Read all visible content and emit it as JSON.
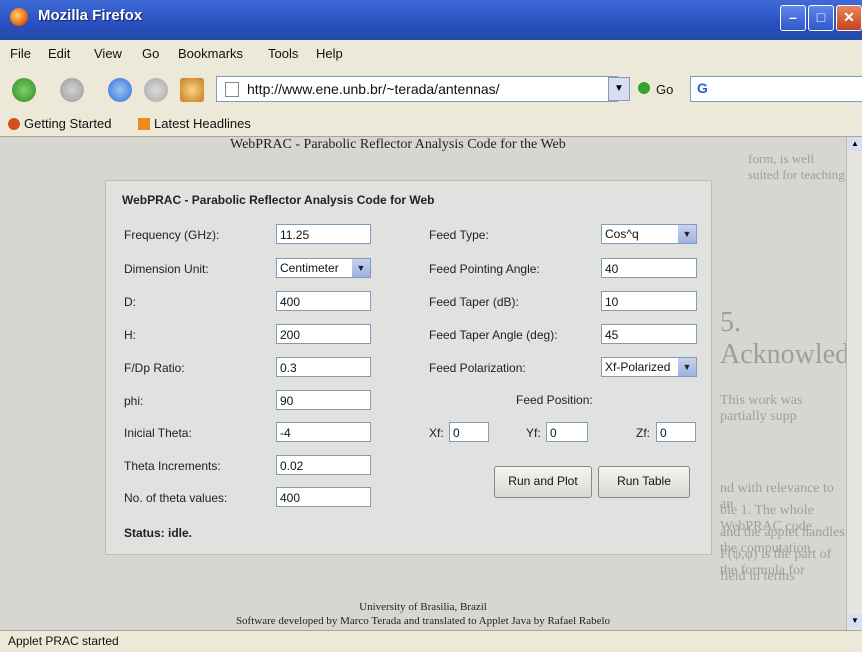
{
  "window": {
    "title": "Mozilla Firefox"
  },
  "menu": [
    "File",
    "Edit",
    "View",
    "Go",
    "Bookmarks",
    "Tools",
    "Help"
  ],
  "toolbar": {
    "url": "http://www.ene.unb.br/~terada/antennas/",
    "go_label": "Go"
  },
  "bookmarks": [
    "Getting Started",
    "Latest Headlines"
  ],
  "page": {
    "header": "WebPRAC - Parabolic Reflector Analysis Code for the Web",
    "bg_fragments": [
      "form, is well suited for teaching",
      "5. Acknowled",
      "This work was partially supp",
      "nd with relevance to an",
      "ble 1. The whole WebPRAC code",
      "and the applet handles the computation",
      "F(ψ,φ) is the part of the formula for",
      "field in terms"
    ],
    "footer_line1": "University of Brasilia, Brazil",
    "footer_line2": "Software developed by Marco Terada and translated to Applet Java by Rafael Rabelo"
  },
  "applet": {
    "title": "WebPRAC - Parabolic Reflector Analysis Code for Web",
    "left_fields": [
      {
        "label": "Frequency (GHz):",
        "value": "11.25"
      },
      {
        "label": "Dimension Unit:",
        "value": "Centimeter",
        "type": "select"
      },
      {
        "label": "D:",
        "value": "400"
      },
      {
        "label": "H:",
        "value": "200"
      },
      {
        "label": "F/Dp Ratio:",
        "value": "0.3"
      },
      {
        "label": "phi:",
        "value": "90"
      },
      {
        "label": "Inicial Theta:",
        "value": "-4"
      },
      {
        "label": "Theta Increments:",
        "value": "0.02"
      },
      {
        "label": "No. of theta values:",
        "value": "400"
      }
    ],
    "right_fields": [
      {
        "label": "Feed Type:",
        "value": "Cos^q",
        "type": "select"
      },
      {
        "label": "Feed Pointing Angle:",
        "value": "40"
      },
      {
        "label": "Feed Taper (dB):",
        "value": "10"
      },
      {
        "label": "Feed Taper Angle (deg):",
        "value": "45"
      },
      {
        "label": "Feed Polarization:",
        "value": "Xf-Polarized",
        "type": "select"
      }
    ],
    "feed_position_label": "Feed Position:",
    "xf": {
      "label": "Xf:",
      "value": "0"
    },
    "yf": {
      "label": "Yf:",
      "value": "0"
    },
    "zf": {
      "label": "Zf:",
      "value": "0"
    },
    "run_plot": "Run and Plot",
    "run_table": "Run Table",
    "status": "Status: idle."
  },
  "status_bar": "Applet PRAC started"
}
